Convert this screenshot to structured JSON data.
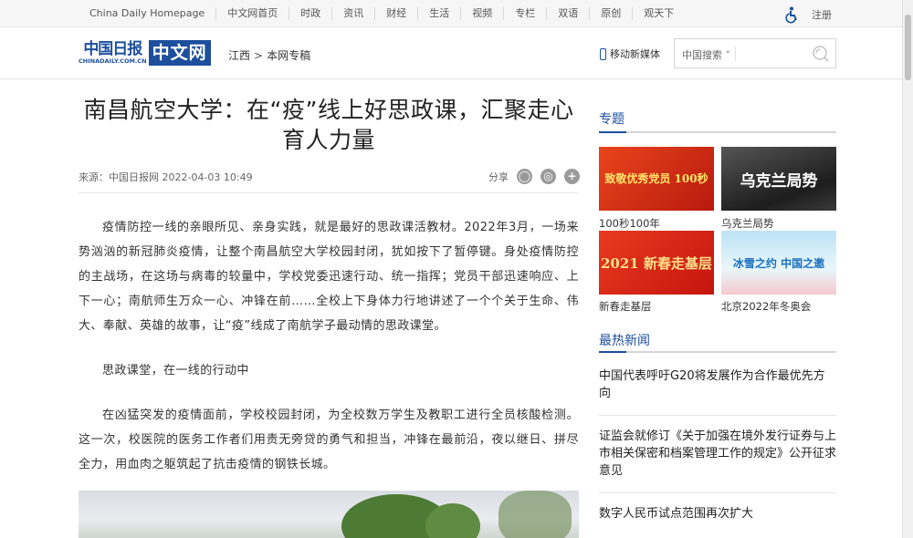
{
  "topnav": {
    "links": [
      "China Daily Homepage",
      "中文网首页",
      "时政",
      "资讯",
      "财经",
      "生活",
      "视频",
      "专栏",
      "双语",
      "原创",
      "观天下"
    ],
    "register": "注册"
  },
  "header": {
    "logo_cd": "中国日报",
    "logo_url": "CHINADAILY.COM.CN",
    "logo_zw": "中文网",
    "breadcrumb": [
      "江西",
      "本网专稿"
    ],
    "breadcrumb_sep": ">",
    "mobile": "移动新媒体",
    "search_scope": "中国搜索 ˅"
  },
  "article": {
    "title": "南昌航空大学：在“疫”线上好思政课，汇聚走心育人力量",
    "meta": "来源：中国日报网 2022-04-03 10:49",
    "share_label": "分享",
    "paragraphs": [
      "疫情防控一线的亲眼所见、亲身实践，就是最好的思政课活教材。2022年3月，一场来势汹汹的新冠肺炎疫情，让整个南昌航空大学校园封闭，犹如按下了暂停键。身处疫情防控的主战场，在这场与病毒的较量中，学校党委迅速行动、统一指挥；党员干部迅速响应、上下一心；南航师生万众一心、冲锋在前……全校上下身体力行地讲述了一个个关于生命、伟大、奉献、英雄的故事，让“疫”线成了南航学子最动情的思政课堂。",
      "思政课堂，在一线的行动中",
      "在凶猛突发的疫情面前，学校校园封闭，为全校数万学生及教职工进行全员核酸检测。这一次，校医院的医务工作者们用责无旁贷的勇气和担当，冲锋在最前沿，夜以继日、拼尽全力，用血肉之躯筑起了抗击疫情的钢铁长城。"
    ]
  },
  "sidebar": {
    "topics_title": "专题",
    "topics": [
      {
        "label": "100秒100年",
        "image_text": "致敬优秀党员 100秒"
      },
      {
        "label": "乌克兰局势",
        "image_text": "乌克兰局势"
      },
      {
        "label": "新春走基层",
        "image_text": "2021 新春走基层"
      },
      {
        "label": "北京2022年冬奥会",
        "image_text": "冰雪之约 中国之邀"
      }
    ],
    "hot_title": "最热新闻",
    "hot_news": [
      "中国代表呼吁G20将发展作为合作最优先方向",
      "证监会就修订《关于加强在境外发行证券与上市相关保密和档案管理工作的规定》公开征求意见",
      "数字人民币试点范围再次扩大"
    ]
  }
}
